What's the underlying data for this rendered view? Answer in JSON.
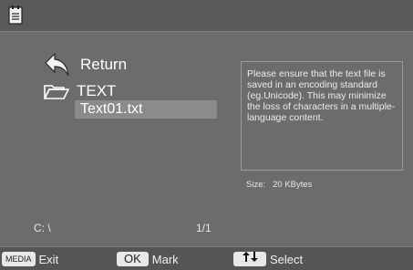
{
  "top": {
    "icon": "notepad-icon"
  },
  "browser": {
    "return_label": "Return",
    "folder_label": "TEXT",
    "selected_file": "Text01.txt",
    "path": "C: \\",
    "page": "1/1"
  },
  "info": {
    "message": "Please ensure that the text file is saved in an encoding standard (eg.Unicode). This may minimize the loss of characters in a multiple-language content.",
    "size_label": "Size:",
    "size_value": "20 KBytes"
  },
  "bottom": {
    "media_key": "MEDIA",
    "exit_label": "Exit",
    "ok_key": "OK",
    "mark_label": "Mark",
    "select_label": "Select"
  },
  "colors": {
    "background": "#6c6c6c",
    "highlight": "#8b8b8b",
    "bar": "#555555"
  }
}
